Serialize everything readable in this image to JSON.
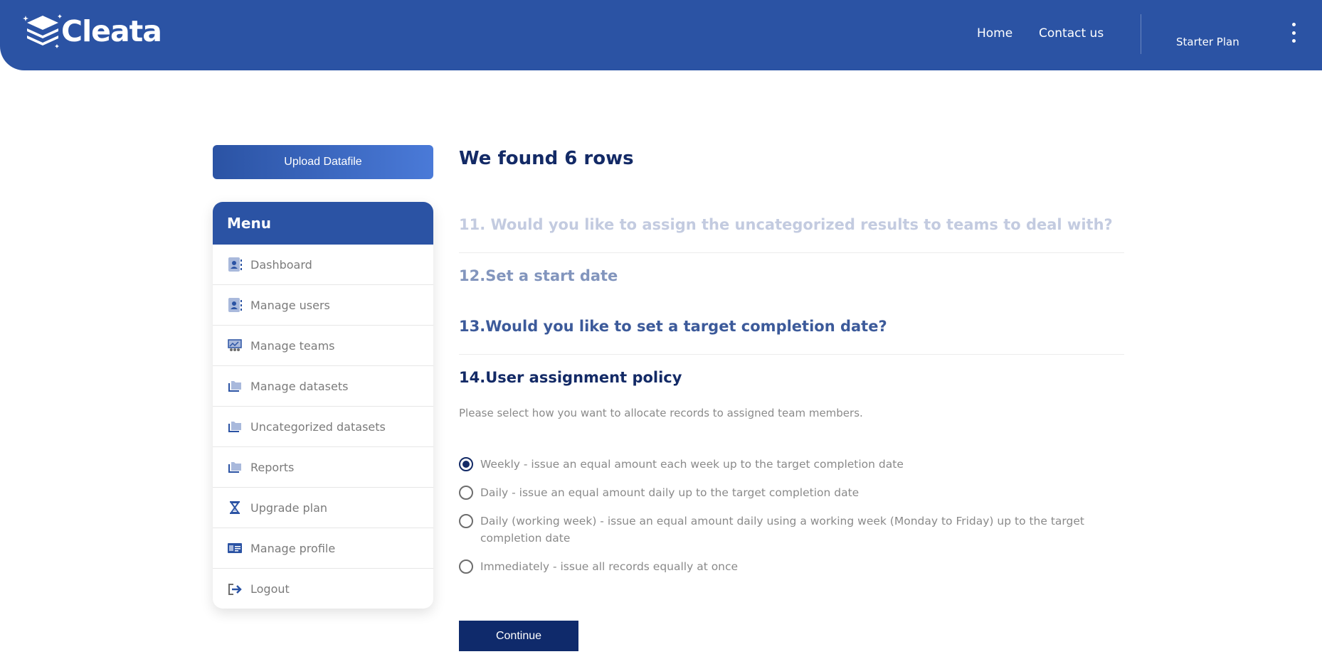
{
  "brand": {
    "name": "Cleata"
  },
  "nav": {
    "home": "Home",
    "contact": "Contact us",
    "plan": "Starter Plan"
  },
  "sidebar": {
    "upload_label": "Upload Datafile",
    "menu_title": "Menu",
    "items": [
      {
        "label": "Dashboard",
        "icon": "contact-book-icon"
      },
      {
        "label": "Manage users",
        "icon": "contact-book-icon"
      },
      {
        "label": "Manage teams",
        "icon": "team-board-icon"
      },
      {
        "label": "Manage datasets",
        "icon": "folders-icon"
      },
      {
        "label": "Uncategorized datasets",
        "icon": "folders-icon"
      },
      {
        "label": "Reports",
        "icon": "folders-icon"
      },
      {
        "label": "Upgrade plan",
        "icon": "hourglass-icon"
      },
      {
        "label": "Manage profile",
        "icon": "id-card-icon"
      },
      {
        "label": "Logout",
        "icon": "logout-icon"
      }
    ]
  },
  "main": {
    "title": "We found 6 rows",
    "steps": [
      {
        "number": "11.",
        "label": "Would you like to assign the uncategorized results to teams to deal with?"
      },
      {
        "number": "12.",
        "label": "Set a start date"
      },
      {
        "number": "13.",
        "label": "Would you like to set a target completion date?"
      },
      {
        "number": "14.",
        "label": "User assignment policy"
      }
    ],
    "description": "Please select how you want to allocate records to assigned team members.",
    "options": [
      {
        "label": "Weekly - issue an equal amount each week up to the target completion date",
        "selected": true
      },
      {
        "label": "Daily - issue an equal amount daily up to the target completion date",
        "selected": false
      },
      {
        "label": "Daily (working week) - issue an equal amount daily using a working week (Monday to Friday) up to the target completion date",
        "selected": false
      },
      {
        "label": "Immediately - issue all records equally at once",
        "selected": false
      }
    ],
    "continue_label": "Continue"
  },
  "colors": {
    "primary": "#2b53a4",
    "navy": "#132a66",
    "button": "#0f2a6b"
  }
}
